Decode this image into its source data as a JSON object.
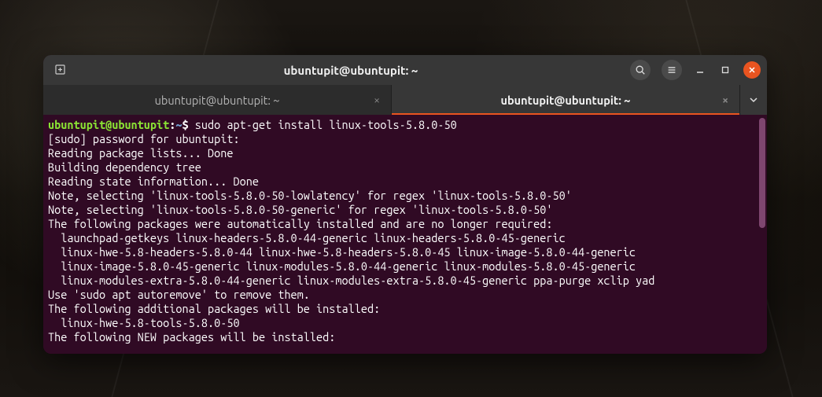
{
  "window": {
    "title": "ubuntupit@ubuntupit: ~"
  },
  "tabs": [
    {
      "label": "ubuntupit@ubuntupit: ~",
      "active": false
    },
    {
      "label": "ubuntupit@ubuntupit: ~",
      "active": true
    }
  ],
  "prompt": {
    "user_host": "ubuntupit@ubuntupit",
    "sep1": ":",
    "path": "~",
    "sep2": "$",
    "command": " sudo apt-get install linux-tools-5.8.0-50"
  },
  "output": [
    "[sudo] password for ubuntupit:",
    "Reading package lists... Done",
    "Building dependency tree",
    "Reading state information... Done",
    "Note, selecting 'linux-tools-5.8.0-50-lowlatency' for regex 'linux-tools-5.8.0-50'",
    "Note, selecting 'linux-tools-5.8.0-50-generic' for regex 'linux-tools-5.8.0-50'",
    "The following packages were automatically installed and are no longer required:",
    "  launchpad-getkeys linux-headers-5.8.0-44-generic linux-headers-5.8.0-45-generic",
    "  linux-hwe-5.8-headers-5.8.0-44 linux-hwe-5.8-headers-5.8.0-45 linux-image-5.8.0-44-generic",
    "  linux-image-5.8.0-45-generic linux-modules-5.8.0-44-generic linux-modules-5.8.0-45-generic",
    "  linux-modules-extra-5.8.0-44-generic linux-modules-extra-5.8.0-45-generic ppa-purge xclip yad",
    "Use 'sudo apt autoremove' to remove them.",
    "The following additional packages will be installed:",
    "  linux-hwe-5.8-tools-5.8.0-50",
    "The following NEW packages will be installed:"
  ],
  "icons": {
    "new_tab": "new-tab-icon",
    "search": "search-icon",
    "menu": "hamburger-icon",
    "minimize": "minimize-icon",
    "maximize": "maximize-icon",
    "close": "close-icon",
    "chevron": "chevron-down-icon",
    "tab_close": "×"
  },
  "colors": {
    "accent": "#e95420",
    "terminal_bg": "#300a24",
    "prompt_green": "#8ae234",
    "prompt_blue": "#729fcf"
  }
}
